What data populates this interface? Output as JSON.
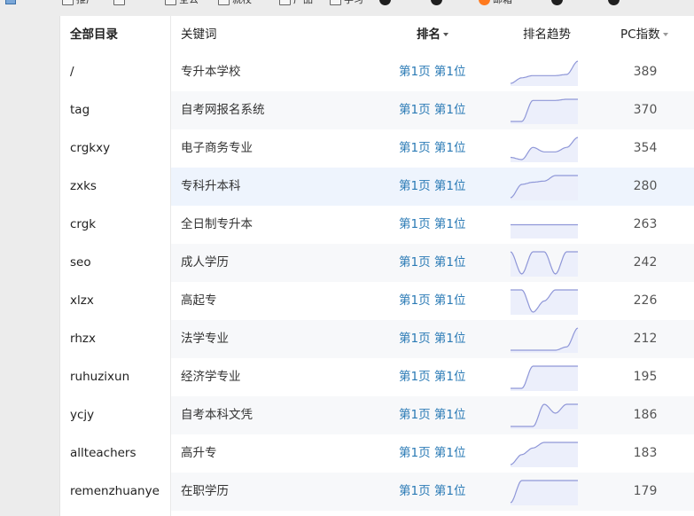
{
  "toolbar": {
    "items": [
      {
        "label": "推广",
        "icon": "doc-icon"
      },
      {
        "label": "",
        "icon": "doc-icon"
      },
      {
        "label": "全公",
        "icon": "doc-icon"
      },
      {
        "label": "就校",
        "icon": "doc-icon"
      },
      {
        "label": "产品",
        "icon": "doc-icon"
      },
      {
        "label": "学习",
        "icon": "doc-icon"
      },
      {
        "label": "",
        "icon": "globe-icon"
      },
      {
        "label": "",
        "icon": "globe-icon"
      },
      {
        "label": "邮箱",
        "icon": "orange-circle-icon"
      },
      {
        "label": "",
        "icon": "globe-icon"
      },
      {
        "label": "",
        "icon": "globe-icon"
      }
    ]
  },
  "table": {
    "headers": {
      "dir": "全部目录",
      "keyword": "关键词",
      "rank": "排名",
      "trend": "排名趋势",
      "pc": "PC指数"
    },
    "highlight_row": 3,
    "rows": [
      {
        "dir": "/",
        "keyword": "专升本学校",
        "rank": "第1页 第1位",
        "pc": "389",
        "trend": [
          0,
          0.25,
          0.35,
          0.35,
          0.35,
          0.4,
          1
        ]
      },
      {
        "dir": "tag",
        "keyword": "自考网报名系统",
        "rank": "第1页 第1位",
        "pc": "370",
        "trend": [
          0,
          0,
          0.95,
          0.95,
          0.95,
          1,
          1
        ]
      },
      {
        "dir": "crgkxy",
        "keyword": "电子商务专业",
        "rank": "第1页 第1位",
        "pc": "354",
        "trend": [
          0.1,
          0,
          0.55,
          0.35,
          0.35,
          0.55,
          1
        ]
      },
      {
        "dir": "zxks",
        "keyword": "专科升本科",
        "rank": "第1页 第1位",
        "pc": "280",
        "trend": [
          0,
          0.6,
          0.7,
          0.75,
          1,
          1,
          1
        ]
      },
      {
        "dir": "crgk",
        "keyword": "全日制专升本",
        "rank": "第1页 第1位",
        "pc": "263",
        "trend": [
          0.5,
          0.5,
          0.5,
          0.5,
          0.5,
          0.5,
          0.5
        ]
      },
      {
        "dir": "seo",
        "keyword": "成人学历",
        "rank": "第1页 第1位",
        "pc": "242",
        "trend": [
          1,
          0,
          1,
          1,
          0,
          1,
          1
        ]
      },
      {
        "dir": "xlzx",
        "keyword": "高起专",
        "rank": "第1页 第1位",
        "pc": "226",
        "trend": [
          1,
          1,
          0,
          0.5,
          1,
          1,
          1
        ]
      },
      {
        "dir": "rhzx",
        "keyword": "法学专业",
        "rank": "第1页 第1位",
        "pc": "212",
        "trend": [
          0,
          0,
          0,
          0,
          0,
          0.15,
          1
        ]
      },
      {
        "dir": "ruhuzixun",
        "keyword": "经济学专业",
        "rank": "第1页 第1位",
        "pc": "195",
        "trend": [
          0,
          0,
          1,
          1,
          1,
          1,
          1
        ]
      },
      {
        "dir": "ycjy",
        "keyword": "自考本科文凭",
        "rank": "第1页 第1位",
        "pc": "186",
        "trend": [
          0,
          0,
          0,
          1,
          0.6,
          1,
          1
        ]
      },
      {
        "dir": "allteachers",
        "keyword": "高升专",
        "rank": "第1页 第1位",
        "pc": "183",
        "trend": [
          0,
          0.45,
          0.75,
          1,
          1,
          1,
          1
        ]
      },
      {
        "dir": "remenzhuanye",
        "keyword": "在职学历",
        "rank": "第1页 第1位",
        "pc": "179",
        "trend": [
          0,
          1,
          1,
          1,
          1,
          1,
          1
        ]
      }
    ]
  }
}
